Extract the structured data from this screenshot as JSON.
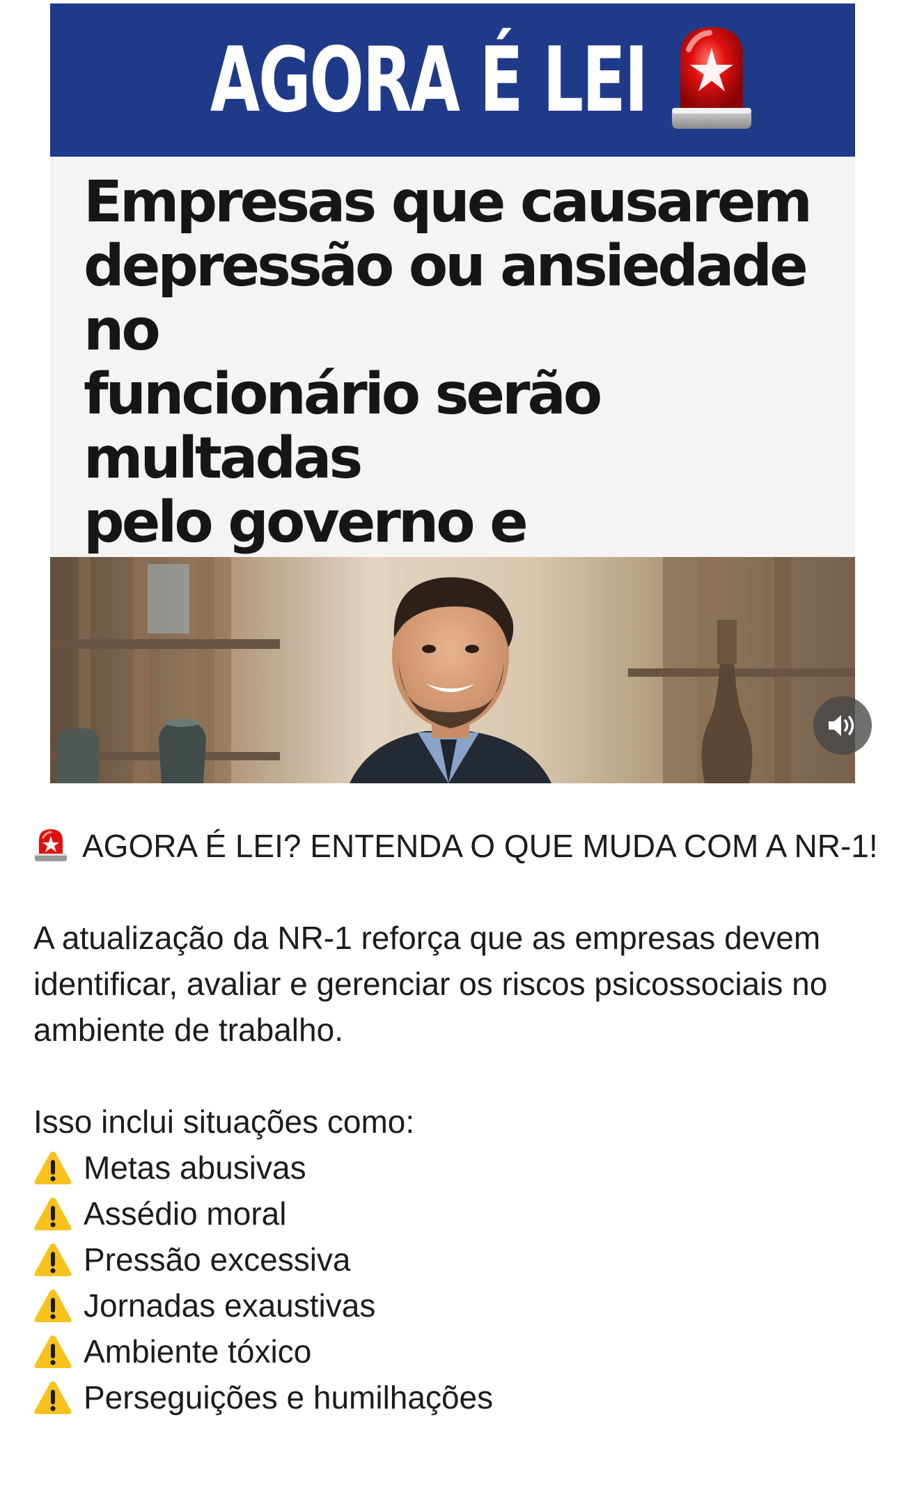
{
  "post": {
    "banner_title": "AGORA É LEI",
    "headline": "Empresas que causarem\ndepressão ou ansiedade no\nfuncionário serão multadas\npelo governo e processadas\npelo empregado; entenda\nmudanças  na legenda",
    "icons": {
      "siren": "siren-emoji-icon",
      "audio": "speaker-volume-icon"
    },
    "colors": {
      "banner": "#203a8a",
      "siren_red": "#e01010"
    }
  },
  "caption": {
    "title_line": "AGORA É LEI? ENTENDA O QUE MUDA COM A NR-1!",
    "paragraph": "A atualização da NR-1 reforça que as empresas devem identificar, avaliar e gerenciar os riscos psicossociais no ambiente de trabalho.",
    "list_intro": "Isso inclui situações como:",
    "items": [
      "Metas abusivas",
      "Assédio moral",
      "Pressão excessiva",
      "Jornadas exaustivas",
      "Ambiente tóxico",
      "Perseguições e humilhações"
    ],
    "item_icon": "warning-emoji-icon"
  }
}
